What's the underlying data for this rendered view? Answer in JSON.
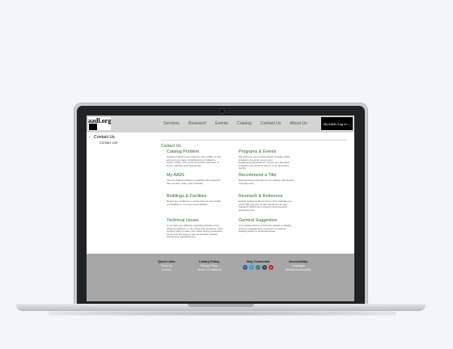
{
  "header": {
    "logo_text": "aadl.org",
    "nav": [
      "Services",
      "Research",
      "Events",
      "Catalog",
      "Contact Us",
      "About Us"
    ],
    "account_label": "My AADL/Log In ⌄"
  },
  "sidebar": {
    "title": "Contact Us",
    "sub": "Contact List"
  },
  "main": {
    "title": "Contact Us",
    "cards": [
      {
        "title": "Catalog Problem",
        "desc": "Catalog problems are related to the inability to find any item you want, including but not limited to books, DVDs, CDs, tools, E-records. Also lists of errors, glitches, and frequencies."
      },
      {
        "title": "Programs & Events",
        "desc": "We welcome your emails pertain to today, AADL programs & events. Leave your suggestions/questions for review, you attended, programs you would to attend, or on upcoming events."
      },
      {
        "title": "My AADL",
        "desc": "You can submit problems regarding their research, their records, fines, and renewals."
      },
      {
        "title": "Recommend a Title",
        "desc": "Recommend a new title for our catalog, that doesn't currently exist."
      },
      {
        "title": "Buildings & Facilities",
        "desc": "Report any problems or issues that you found with our facilities or comment our buildings."
      },
      {
        "title": "Research & Reference",
        "desc": "Having questions about how to find materials you want? We and your to use references for any research! Submit any research and reference questions here."
      },
      {
        "title": "Technical Issues",
        "desc": "If you have any difficulty regarding website errors, account problems, or any other tech problems, we're working hard to make your online library experience as smooth and easy to use as possible. Please submit your questions here."
      },
      {
        "title": "General Suggestion",
        "desc": "Any problem that is not directly related to catalog, account management, resources, programs, building facility or technical issues."
      }
    ]
  },
  "footer": {
    "cols": [
      {
        "head": "Quick Links",
        "links": [
          "Press Kit",
          "Careers"
        ]
      },
      {
        "head": "Library Policy",
        "links": [
          "Privacy Policy",
          "Terms & Conditions"
        ]
      },
      {
        "head": "Stay Connected",
        "links": []
      },
      {
        "head": "Accessibility",
        "links": [
          "Languages",
          "Website Accessibility"
        ]
      }
    ],
    "social": [
      {
        "icon": "facebook-icon",
        "glyph": "f",
        "color": "#3b5998"
      },
      {
        "icon": "twitter-icon",
        "glyph": "t",
        "color": "#1da1f2"
      },
      {
        "icon": "instagram-icon",
        "glyph": "i",
        "color": "#4a6f8a"
      },
      {
        "icon": "tumblr-icon",
        "glyph": "t",
        "color": "#35465c"
      },
      {
        "icon": "youtube-icon",
        "glyph": "▸",
        "color": "#cc2222"
      }
    ]
  },
  "colors": {
    "accent": "#2e6b2e",
    "footer_bg": "#a7a7a7",
    "header_bg": "#d4d4d4"
  }
}
